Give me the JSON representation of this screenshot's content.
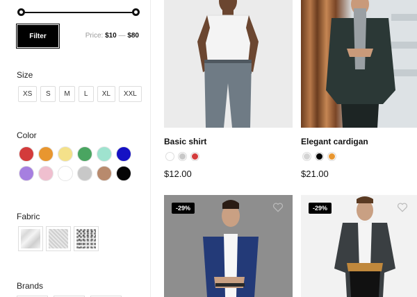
{
  "filter": {
    "button_label": "Filter",
    "price_prefix": "Price:",
    "price_min": "$10",
    "price_sep": "—",
    "price_max": "$80"
  },
  "size": {
    "title": "Size",
    "options": [
      "XS",
      "S",
      "M",
      "L",
      "XL",
      "XXL"
    ]
  },
  "color": {
    "title": "Color",
    "swatches": [
      "#d33b3b",
      "#e8962f",
      "#f4e18a",
      "#4aa561",
      "#9fe3cf",
      "#1511c4",
      "#a67fe0",
      "#efbfcf",
      "#ffffff",
      "#c8c8c8",
      "#b88a6d",
      "#050505"
    ]
  },
  "fabric": {
    "title": "Fabric",
    "items": [
      "fabric-silk",
      "fabric-knit",
      "fabric-lace"
    ]
  },
  "brands": {
    "title": "Brands"
  },
  "products": [
    {
      "name": "Basic shirt",
      "price": "$12.00",
      "colors": [
        "#ffffff",
        "#c8c8c8",
        "#d33b3b"
      ]
    },
    {
      "name": "Elegant cardigan",
      "price": "$21.00",
      "colors": [
        "#d4d4d4",
        "#050505",
        "#e8962f"
      ]
    },
    {
      "badge": "-29%"
    },
    {
      "badge": "-29%"
    }
  ]
}
